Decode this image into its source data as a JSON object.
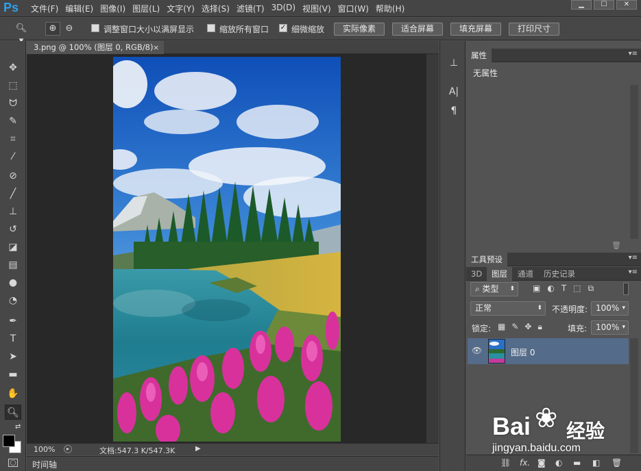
{
  "app": {
    "logo": "Ps"
  },
  "menu": [
    "文件(F)",
    "编辑(E)",
    "图像(I)",
    "图层(L)",
    "文字(Y)",
    "选择(S)",
    "滤镜(T)",
    "3D(D)",
    "视图(V)",
    "窗口(W)",
    "帮助(H)"
  ],
  "window_controls": [
    "minimize-icon",
    "maximize-icon",
    "close-icon"
  ],
  "options": {
    "resize_windows": {
      "label": "调整窗口大小以满屏显示",
      "checked": false
    },
    "zoom_all": {
      "label": "缩放所有窗口",
      "checked": false
    },
    "scrubby_zoom": {
      "label": "细微缩放",
      "checked": true
    },
    "buttons": [
      "实际像素",
      "适合屏幕",
      "填充屏幕",
      "打印尺寸"
    ]
  },
  "document": {
    "tab_title": "3.png @ 100% (图层 0, RGB/8)",
    "zoom": "100%",
    "doc_info": "文档:547.3 K/547.3K"
  },
  "timeline_label": "时间轴",
  "properties": {
    "tab": "属性",
    "content": "无属性"
  },
  "tool_presets_tab": "工具预设",
  "layers_panel": {
    "tabs": [
      "3D",
      "图层",
      "通道",
      "历史记录"
    ],
    "active_tab": "图层",
    "filter": "类型",
    "blend_mode": "正常",
    "opacity_label": "不透明度:",
    "opacity": "100%",
    "lock_label": "锁定:",
    "fill_label": "填充:",
    "fill": "100%",
    "layers": [
      {
        "name": "图层 0",
        "visible": true
      }
    ]
  },
  "watermark": {
    "brand": "Bai",
    "brand2": "经验",
    "url": "jingyan.baidu.com"
  },
  "colors": {
    "accent": "#2fa0ee",
    "selected_layer": "#546b8a"
  }
}
